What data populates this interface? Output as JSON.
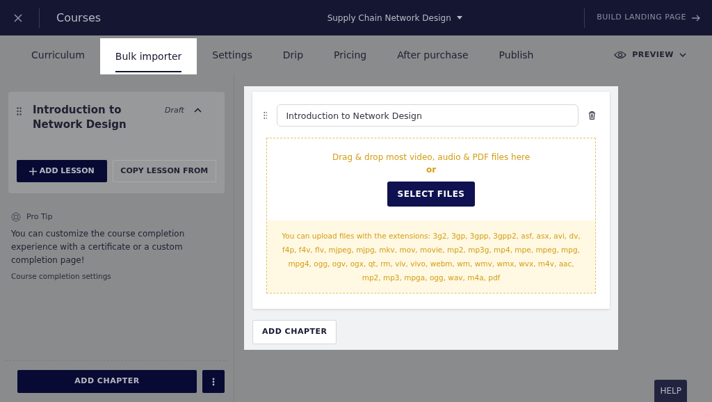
{
  "header": {
    "title": "Courses",
    "course": "Supply Chain Network Design",
    "build_button": "BUILD LANDING PAGE"
  },
  "tabs": [
    {
      "label": "Curriculum",
      "selected": false
    },
    {
      "label": "Bulk importer",
      "selected": true
    },
    {
      "label": "Settings",
      "selected": false
    },
    {
      "label": "Drip",
      "selected": false
    },
    {
      "label": "Pricing",
      "selected": false
    },
    {
      "label": "After purchase",
      "selected": false
    },
    {
      "label": "Publish",
      "selected": false
    }
  ],
  "preview": "PREVIEW",
  "sidebar": {
    "chapter": {
      "title": "Introduction to Network Design",
      "status": "Draft",
      "expanded": true
    },
    "add_lesson": "ADD LESSON",
    "copy_lesson": "COPY LESSON FROM",
    "pro_tip": {
      "title": "Pro Tip",
      "text": "You can customize the course completion experience with a certificate or a custom completion page!",
      "link": "Course completion settings"
    },
    "add_chapter": "ADD CHAPTER"
  },
  "editor": {
    "chapter_title": "Introduction to Network Design",
    "drop_text": "Drag & drop most video, audio & PDF files here",
    "or": "or",
    "select_button": "SELECT FILES",
    "extensions": "You can upload files with the extensions: 3g2, 3gp, 3gpp, 3gpp2, asf, asx, avi, dv, f4p, f4v, flv, mjpeg, mjpg, mkv, mov, movie, mp2, mp3g, mp4, mpe, mpeg, mpg, mpg4, ogg, ogv, ogx, qt, rm, viv, vivo, webm, wm, wmv, wmx, wvx, m4v, aac, mp2, mp3, mpga, ogg, wav, m4a, pdf",
    "add_chapter": "ADD CHAPTER"
  },
  "help": "HELP"
}
